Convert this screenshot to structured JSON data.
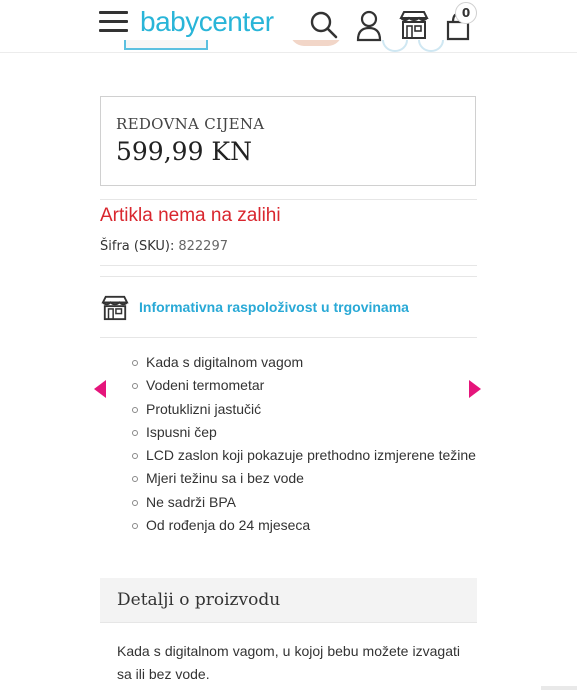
{
  "header": {
    "logo": "babycenter",
    "icons": [
      "menu-icon",
      "search-icon",
      "user-icon",
      "store-icon",
      "cart-icon"
    ],
    "cart_count": "0"
  },
  "price": {
    "label": "REDOVNA CIJENA",
    "value": "599,99 KN"
  },
  "availability": {
    "stock_status": "Artikla nema na zalihi",
    "sku_label": "Šifra (SKU):",
    "sku_value": "822297"
  },
  "store": {
    "icon": "store-icon",
    "link_label": "Informativna raspoloživost u trgovinama"
  },
  "carousel": {
    "prev_icon": "arrow-left-icon",
    "next_icon": "arrow-right-icon",
    "features": [
      "Kada s digitalnom vagom",
      "Vodeni termometar",
      "Protuklizni jastučić",
      "Ispusni čep",
      "LCD zaslon koji pokazuje prethodno izmjerene težine",
      "Mjeri težinu sa i bez vode",
      "Ne sadrži BPA",
      "Od rođenja do 24 mjeseca"
    ]
  },
  "details": {
    "title": "Detalji o proizvodu",
    "description": "Kada s digitalnom vagom, u kojoj bebu možete izvagati sa ili bez vode."
  },
  "colors": {
    "brand": "#29b5d8",
    "link": "#29a9d6",
    "out_of_stock": "#d9262e",
    "arrow": "#e5157b"
  }
}
